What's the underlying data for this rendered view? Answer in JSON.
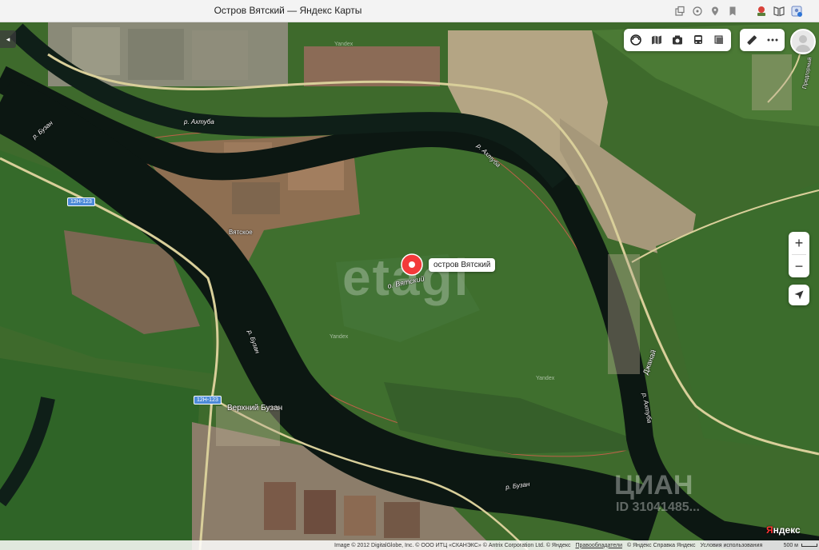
{
  "window": {
    "title": "Остров Вятский — Яндекс Карты"
  },
  "browser_icons": [
    "tab-group-icon",
    "extensions-icon",
    "location-icon",
    "bookmark-icon",
    "profile-sticker-icon",
    "reader-icon",
    "account-icon"
  ],
  "map": {
    "pin_label": "остров Вятский",
    "island_label": "о. Вятский",
    "rivers": {
      "akhtuba_top": "р. Ахтуба",
      "akhtuba_right": "р. Ахтуба",
      "akhtuba_lower": "р. Ахтуба",
      "buzan_left": "р. Бузан",
      "buzan_mid": "р. Бузан",
      "buzan_bottom": "р. Бузан"
    },
    "settlements": {
      "vyatskoe": "Вятское",
      "verkhniy_buzan": "Верхний Бузан",
      "dzhanai": "Джанай",
      "podgornoe_partial": "Предгорный"
    },
    "roads": {
      "shield_1": "12Н-123",
      "shield_2": "12Н-123"
    },
    "yandex_marks": [
      "Yandex",
      "Yandex",
      "Yandex"
    ],
    "watermark": "etagi",
    "watermark_cian": "ЦИАН",
    "watermark_cian_id": "ID 31041485..."
  },
  "controls": {
    "top_tools": [
      "layers-icon",
      "panorama-icon",
      "camera-icon",
      "bus-icon",
      "layers-stack-icon"
    ],
    "ruler": "ruler-icon",
    "more": "more-icon",
    "zoom_in": "+",
    "zoom_out": "−",
    "side_handle": "◂"
  },
  "footer": {
    "logo_y": "Я",
    "logo_rest": "ндекс",
    "attribution": "Image © 2012 DigitalGlobe, Inc. © ООО ИТЦ «СКАНЭКС» © Antrix Corporation Ltd. © Яндекс",
    "terms": "Правообладатели",
    "links": "© Яндекс  Справка  Яндекс",
    "misc": "Условия использования",
    "scale": "500 м"
  },
  "colors": {
    "river": "#0d1a14",
    "field_green": "#3f6b2e",
    "field_brown": "#8c6a4e",
    "pin": "#f33a3a"
  }
}
